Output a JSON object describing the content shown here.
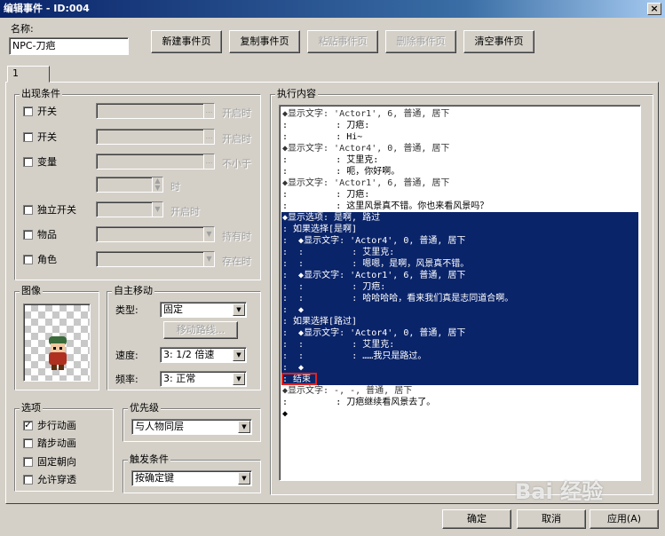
{
  "window": {
    "title": "编辑事件 - ID:004",
    "close": "×"
  },
  "name": {
    "label": "名称:",
    "value": "NPC-刀疤"
  },
  "toolbar": {
    "new": "新建事件页",
    "copy": "复制事件页",
    "paste": "粘贴事件页",
    "delete": "删除事件页",
    "clear": "清空事件页"
  },
  "tab": {
    "label": "1"
  },
  "conditions": {
    "title": "出现条件",
    "switch1": {
      "label": "开关",
      "suffix": "开启时"
    },
    "switch2": {
      "label": "开关",
      "suffix": "开启时"
    },
    "variable": {
      "label": "变量",
      "suffix": "不小于",
      "unit": "时"
    },
    "self_switch": {
      "label": "独立开关",
      "suffix": "开启时"
    },
    "item": {
      "label": "物品",
      "suffix": "持有时"
    },
    "actor": {
      "label": "角色",
      "suffix": "存在时"
    }
  },
  "graphic": {
    "title": "图像"
  },
  "autonomous": {
    "title": "自主移动",
    "type_label": "类型:",
    "type_value": "固定",
    "route_button": "移动路线...",
    "speed_label": "速度:",
    "speed_value": "3: 1/2 倍速",
    "freq_label": "频率:",
    "freq_value": "3: 正常"
  },
  "options": {
    "title": "选项",
    "walk": "步行动画",
    "step": "踏步动画",
    "fixed": "固定朝向",
    "through": "允许穿透",
    "walk_checked": "✓"
  },
  "priority": {
    "title": "优先级",
    "value": "与人物同层"
  },
  "trigger": {
    "title": "触发条件",
    "value": "按确定键"
  },
  "execution": {
    "title": "执行内容",
    "lines": [
      "◆显示文字: 'Actor1', 6, 普通, 居下",
      ":         : 刀疤:",
      ":         : Hi~",
      "◆显示文字: 'Actor4', 0, 普通, 居下",
      ":         : 艾里克:",
      ":         : 呃，你好啊。",
      "◆显示文字: 'Actor1', 6, 普通, 居下",
      ":         : 刀疤:",
      ":         : 这里风景真不错。你也来看风景吗？",
      "◆显示选项: 是啊, 路过",
      ": 如果选择[是啊]",
      ":  ◆显示文字: 'Actor4', 0, 普通, 居下",
      ":  :         : 艾里克:",
      ":  :         : 嗯嗯，是啊，风景真不错。",
      ":  ◆显示文字: 'Actor1', 6, 普通, 居下",
      ":  :         : 刀疤:",
      ":  :         : 哈哈哈哈，看来我们真是志同道合啊。",
      ":  ◆",
      ": 如果选择[路过]",
      ":  ◆显示文字: 'Actor4', 0, 普通, 居下",
      ":  :         : 艾里克:",
      ":  :         : ……我只是路过。",
      ":  ◆",
      ": 结束",
      "◆显示文字: -, -, 普通, 居下",
      ":         : 刀疤继续看风景去了。",
      "◆"
    ]
  },
  "footer": {
    "ok": "确定",
    "cancel": "取消",
    "apply": "应用(A)"
  },
  "watermark": "Bai 经验"
}
